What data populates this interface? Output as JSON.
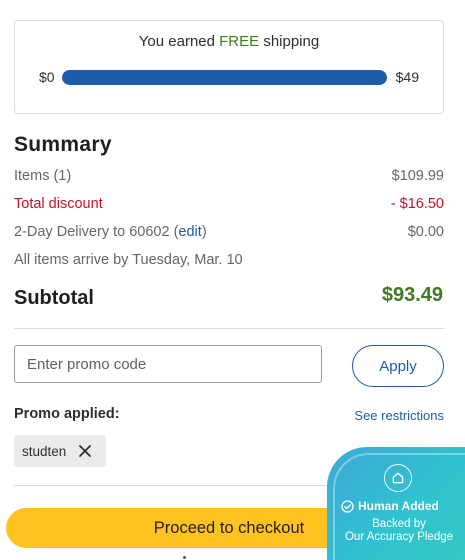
{
  "shipping": {
    "message_prefix": "You earned ",
    "message_free": "FREE",
    "message_suffix": " shipping",
    "min_label": "$0",
    "max_label": "$49",
    "progress_fraction": 1.0
  },
  "summary": {
    "title": "Summary",
    "items_label": "Items (1)",
    "items_value": "$109.99",
    "discount_label": "Total discount",
    "discount_value": "- $16.50",
    "delivery_label_prefix": "2-Day Delivery to 60602 (",
    "delivery_edit": "edit",
    "delivery_label_suffix": ")",
    "delivery_value": "$0.00",
    "arrival_note": "All items arrive by Tuesday, Mar. 10",
    "subtotal_label": "Subtotal",
    "subtotal_value": "$93.49"
  },
  "promo": {
    "placeholder": "Enter promo code",
    "apply_label": "Apply",
    "applied_label": "Promo applied:",
    "restrictions_link": "See restrictions",
    "applied_code": "studten"
  },
  "checkout": {
    "button_label": "Proceed to checkout"
  },
  "trust_badge": {
    "icon": "home-shield-icon",
    "title": "Human Added",
    "subtitle_line1": "Backed by",
    "subtitle_line2": "Our Accuracy Pledge"
  },
  "colors": {
    "accent_blue": "#1d5cab",
    "free_green": "#3d7b1f",
    "discount_red": "#c8102e",
    "checkout_yellow": "#ffc220",
    "badge_teal": "#2fc3cf"
  }
}
